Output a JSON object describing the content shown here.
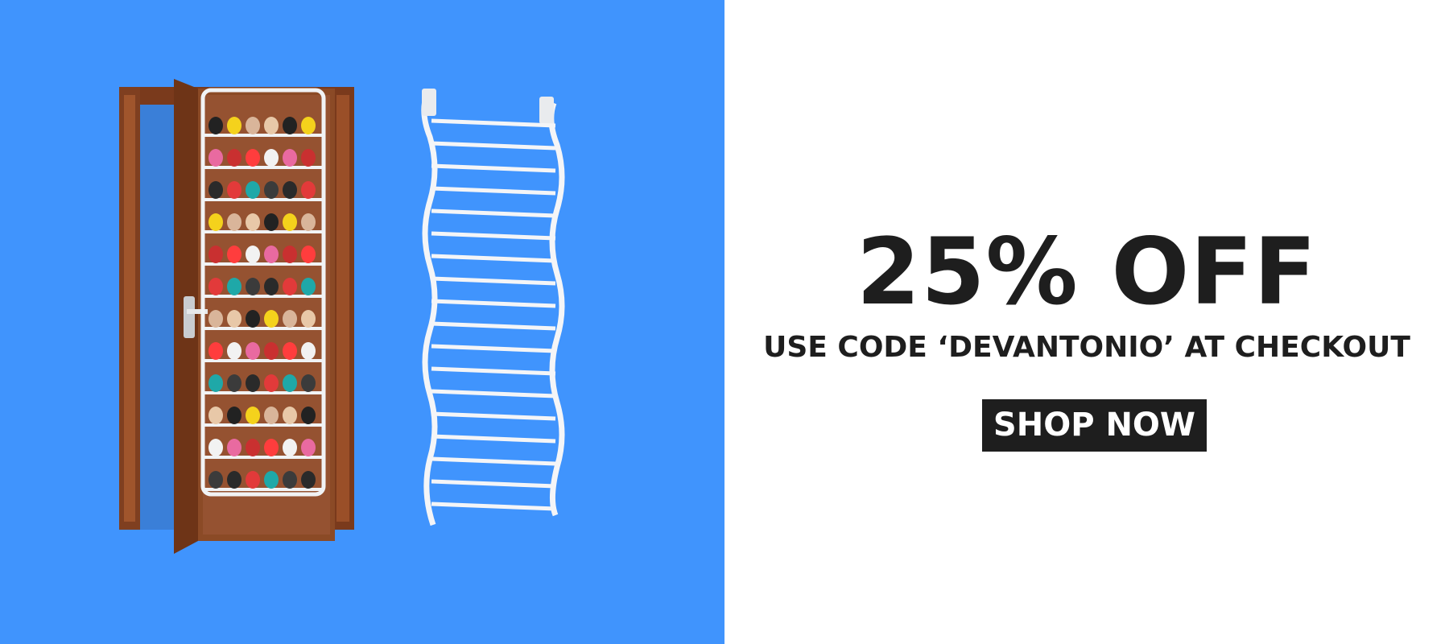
{
  "colors": {
    "left_background": "#4094fd",
    "right_background": "#ffffff",
    "text": "#1e1e1e",
    "button_background": "#1e1e1e",
    "button_text": "#ffffff"
  },
  "promo": {
    "headline": "25% OFF",
    "subline": "USE CODE ‘DEVANTONIO’ AT CHECKOUT",
    "button_label": "SHOP NOW"
  },
  "images": {
    "door_organizer": "door-with-shoe-organizer-image",
    "empty_rack": "empty-shoe-rack-image"
  }
}
